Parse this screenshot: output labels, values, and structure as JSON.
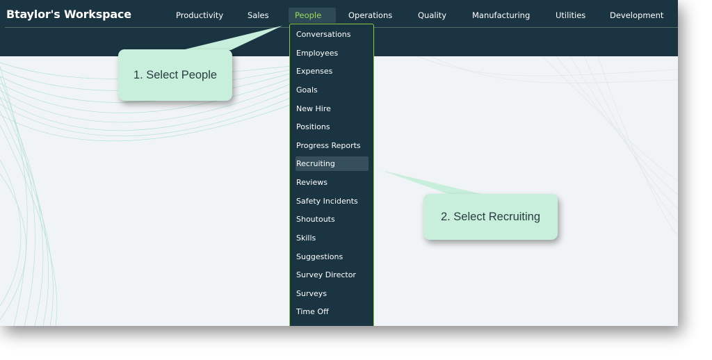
{
  "app": {
    "title": "Btaylor's Workspace"
  },
  "nav": [
    {
      "label": "Productivity"
    },
    {
      "label": "Sales"
    },
    {
      "label": "People"
    },
    {
      "label": "Operations"
    },
    {
      "label": "Quality"
    },
    {
      "label": "Manufacturing"
    },
    {
      "label": "Utilities"
    },
    {
      "label": "Development"
    }
  ],
  "active_nav": "People",
  "people_menu": {
    "items": [
      "Conversations",
      "Employees",
      "Expenses",
      "Goals",
      "New Hire",
      "Positions",
      "Progress Reports",
      "Recruiting",
      "Reviews",
      "Safety Incidents",
      "Shoutouts",
      "Skills",
      "Suggestions",
      "Survey Director",
      "Surveys",
      "Time Off"
    ],
    "selected": "Recruiting"
  },
  "callouts": {
    "step1": "1. Select People",
    "step2": "2. Select Recruiting"
  },
  "colors": {
    "topbar": "#1b3442",
    "accent": "#9bdc54",
    "menu_border": "#8bc93f",
    "callout": "#c8efdb",
    "background": "#f1f4f6"
  }
}
